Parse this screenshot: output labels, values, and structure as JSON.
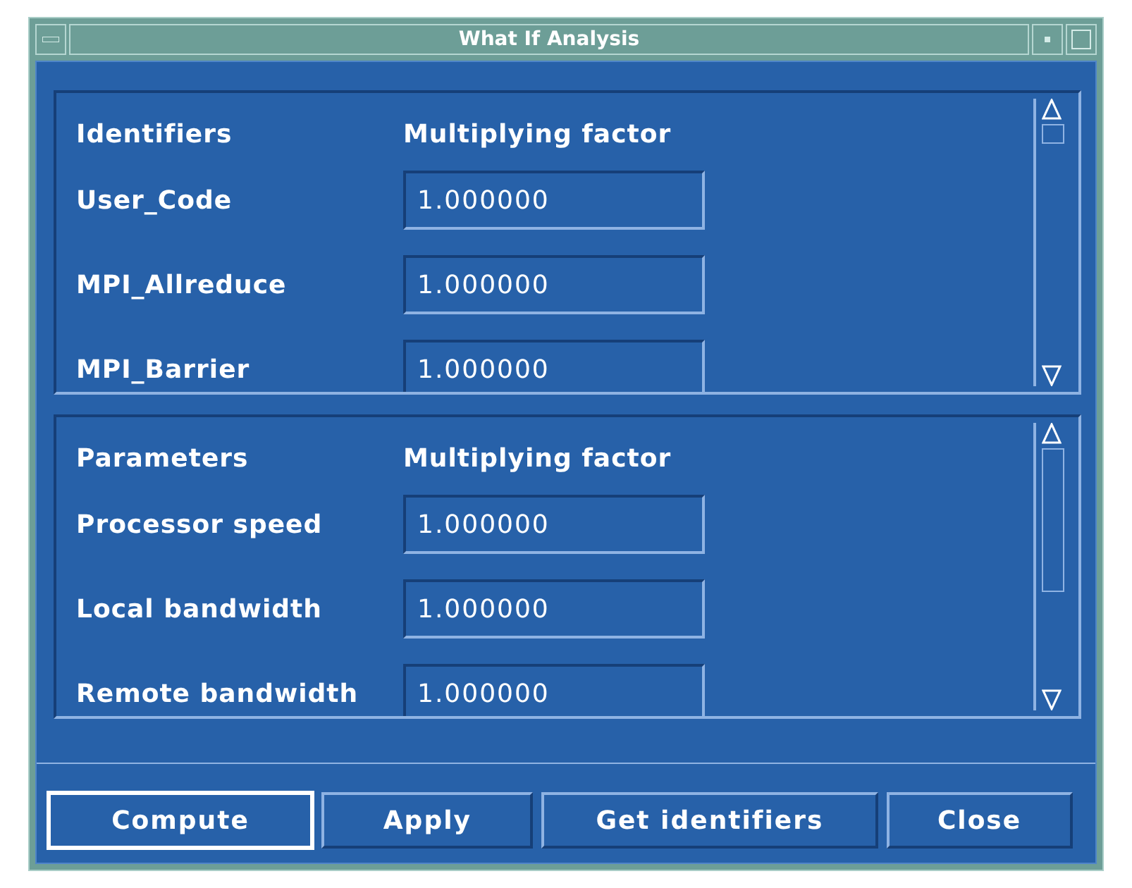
{
  "window": {
    "title": "What If Analysis"
  },
  "panes": [
    {
      "heading": "Identifiers",
      "value_heading": "Multiplying factor",
      "rows": [
        {
          "label": "User_Code",
          "value": "1.000000"
        },
        {
          "label": "MPI_Allreduce",
          "value": "1.000000"
        },
        {
          "label": "MPI_Barrier",
          "value": "1.000000"
        }
      ]
    },
    {
      "heading": "Parameters",
      "value_heading": "Multiplying factor",
      "rows": [
        {
          "label": "Processor speed",
          "value": "1.000000"
        },
        {
          "label": "Local bandwidth",
          "value": "1.000000"
        },
        {
          "label": "Remote bandwidth",
          "value": "1.000000"
        }
      ]
    }
  ],
  "buttons": [
    {
      "label": "Compute",
      "default": true
    },
    {
      "label": "Apply",
      "default": false
    },
    {
      "label": "Get identifiers",
      "default": false
    },
    {
      "label": "Close",
      "default": false
    }
  ]
}
